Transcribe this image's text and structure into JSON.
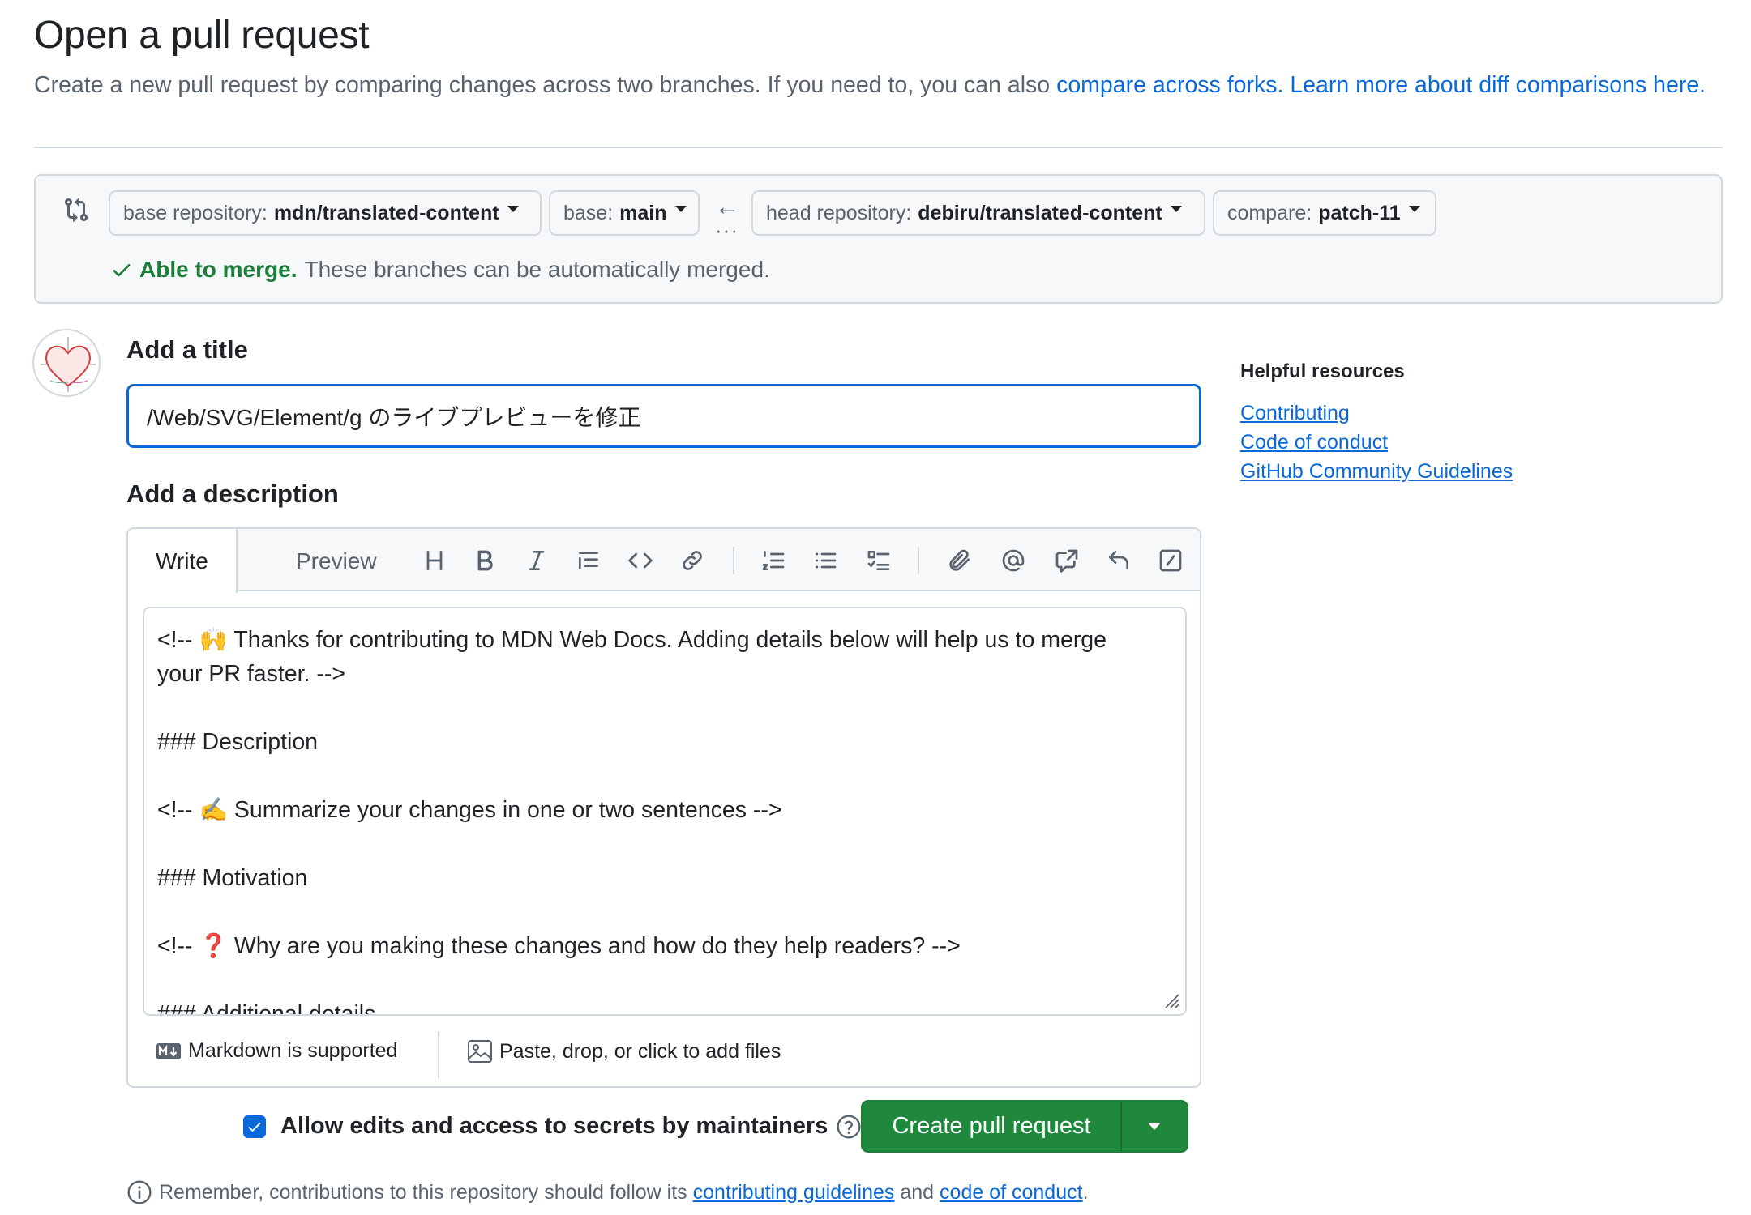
{
  "header": {
    "title": "Open a pull request",
    "subtitle_text": "Create a new pull request by comparing changes across two branches. If you need to, you can also ",
    "link_forks": "compare across forks.",
    "link_learn": "Learn more about diff comparisons here."
  },
  "compare": {
    "base_repo_label": "base repository:",
    "base_repo_value": "mdn/translated-content",
    "base_label": "base:",
    "base_value": "main",
    "head_repo_label": "head repository:",
    "head_repo_value": "debiru/translated-content",
    "compare_label": "compare:",
    "compare_value": "patch-11",
    "arrow": "←",
    "dots": "···",
    "merge_ok": "Able to merge.",
    "merge_text": "These branches can be automatically merged."
  },
  "form": {
    "title_label": "Add a title",
    "title_value": "/Web/SVG/Element/g のライブプレビューを修正",
    "description_label": "Add a description"
  },
  "editor": {
    "tab_write": "Write",
    "tab_preview": "Preview",
    "lines": [
      "<!-- 🙌 Thanks for contributing to MDN Web Docs. Adding details below will help us to merge",
      "your PR faster. -->",
      "",
      "### Description",
      "",
      "<!-- ✍️ Summarize your changes in one or two sentences -->",
      "",
      "### Motivation",
      "",
      "<!-- ❓ Why are you making these changes and how do they help readers? -->",
      "",
      "### Additional details"
    ],
    "markdown_note": "Markdown is supported",
    "files_note": "Paste, drop, or click to add files"
  },
  "actions": {
    "allow_edits": "Allow edits and access to secrets by maintainers",
    "create_button": "Create pull request",
    "remember_text": "Remember, contributions to this repository should follow its",
    "contributing_guidelines": "contributing guidelines",
    "and_text": "and",
    "code_of_conduct": "code of conduct",
    "period": "."
  },
  "sidebar": {
    "title": "Helpful resources",
    "links": [
      "Contributing",
      "Code of conduct",
      "GitHub Community Guidelines"
    ]
  },
  "colors": {
    "accent": "#0969da",
    "success": "#1a7f37",
    "primary_button": "#1f883d"
  }
}
